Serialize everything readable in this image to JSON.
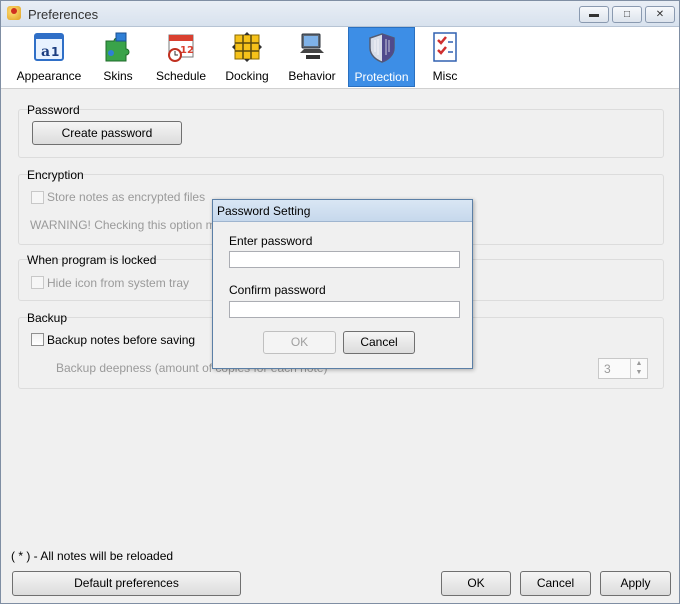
{
  "window": {
    "title": "Preferences",
    "minimize": "▬",
    "maximize": "□",
    "close": "✕"
  },
  "toolbar": {
    "items": [
      {
        "label": "Appearance",
        "icon": "appearance-icon"
      },
      {
        "label": "Skins",
        "icon": "puzzle-icon"
      },
      {
        "label": "Schedule",
        "icon": "calendar-clock-icon"
      },
      {
        "label": "Docking",
        "icon": "docking-grid-icon"
      },
      {
        "label": "Behavior",
        "icon": "computer-icon"
      },
      {
        "label": "Protection",
        "icon": "shield-icon",
        "active": true
      },
      {
        "label": "Misc",
        "icon": "checklist-icon"
      }
    ],
    "active_color": "#3d8ee6"
  },
  "password": {
    "label": "Password",
    "create_button": "Create password"
  },
  "encryption": {
    "label": "Encryption",
    "checkbox": "Store notes as encrypted files",
    "warning": "WARNING! Checking this option ma"
  },
  "locked": {
    "label": "When program is locked",
    "checkbox": "Hide icon from system tray"
  },
  "backup": {
    "label": "Backup",
    "checkbox": "Backup notes before saving",
    "deepness_label": "Backup deepness (amount of copies for each note)",
    "deepness_value": "3"
  },
  "dialog": {
    "title": "Password Setting",
    "enter_label": "Enter password",
    "enter_value": "",
    "confirm_label": "Confirm password",
    "confirm_value": "",
    "ok": "OK",
    "cancel": "Cancel"
  },
  "footer": {
    "note": "( * ) - All notes will be reloaded",
    "default_button": "Default preferences",
    "ok": "OK",
    "cancel": "Cancel",
    "apply": "Apply"
  }
}
